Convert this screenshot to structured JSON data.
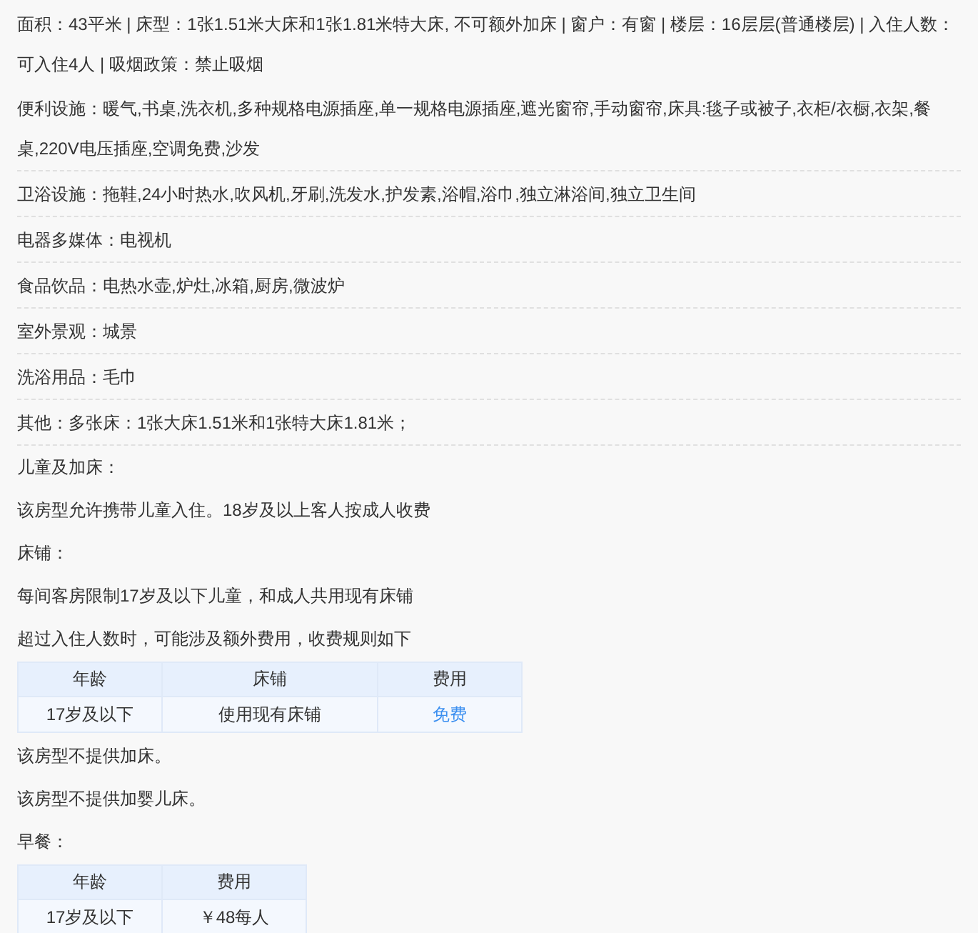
{
  "info": [
    {
      "kind": "summary",
      "text": "面积：43平米 | 床型：1张1.51米大床和1张1.81米特大床, 不可额外加床 | 窗户：有窗 | 楼层：16层层(普通楼层) | 入住人数：可入住4人 | 吸烟政策：禁止吸烟"
    },
    {
      "kind": "facility",
      "text": "便利设施：暖气,书桌,洗衣机,多种规格电源插座,单一规格电源插座,遮光窗帘,手动窗帘,床具:毯子或被子,衣柜/衣橱,衣架,餐桌,220V电压插座,空调免费,沙发"
    },
    {
      "kind": "facility",
      "text": "卫浴设施：拖鞋,24小时热水,吹风机,牙刷,洗发水,护发素,浴帽,浴巾,独立淋浴间,独立卫生间"
    },
    {
      "kind": "facility",
      "text": "电器多媒体：电视机"
    },
    {
      "kind": "facility",
      "text": "食品饮品：电热水壶,炉灶,冰箱,厨房,微波炉"
    },
    {
      "kind": "facility",
      "text": "室外景观：城景"
    },
    {
      "kind": "facility",
      "text": "洗浴用品：毛巾"
    },
    {
      "kind": "facility",
      "text": "其他：多张床：1张大床1.51米和1张特大床1.81米；"
    }
  ],
  "policy": [
    {
      "kind": "text",
      "text": "儿童及加床："
    },
    {
      "kind": "text",
      "text": "该房型允许携带儿童入住。18岁及以上客人按成人收费"
    },
    {
      "kind": "text",
      "text": "床铺："
    },
    {
      "kind": "text",
      "text": "每间客房限制17岁及以下儿童，和成人共用现有床铺"
    },
    {
      "kind": "text",
      "text": "超过入住人数时，可能涉及额外费用，收费规则如下"
    },
    {
      "kind": "table",
      "columns": [
        "年龄",
        "床铺",
        "费用"
      ],
      "rows": [
        [
          {
            "text": "17岁及以下"
          },
          {
            "text": "使用现有床铺"
          },
          {
            "text": "免费",
            "accent": true
          }
        ]
      ]
    },
    {
      "kind": "text",
      "text": "该房型不提供加床。"
    },
    {
      "kind": "text",
      "text": "该房型不提供加婴儿床。"
    },
    {
      "kind": "text",
      "text": "早餐："
    },
    {
      "kind": "table",
      "columns": [
        "年龄",
        "费用"
      ],
      "rows": [
        [
          {
            "text": "17岁及以下"
          },
          {
            "text": "￥48每人"
          }
        ]
      ]
    }
  ]
}
